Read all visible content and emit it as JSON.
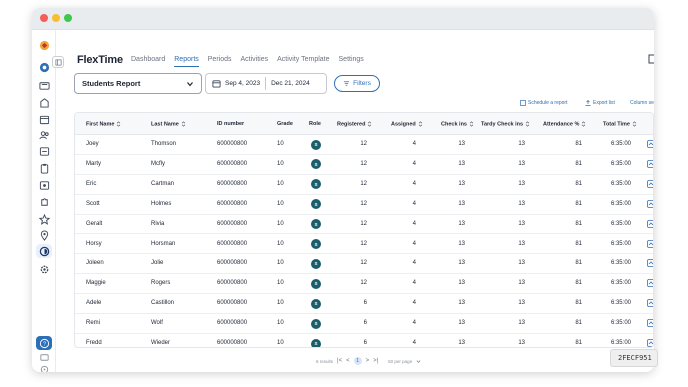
{
  "app": {
    "brand": "FlexTime",
    "nav": [
      "Dashboard",
      "Reports",
      "Periods",
      "Activities",
      "Activity Template",
      "Settings"
    ],
    "active_nav": "Reports"
  },
  "toolbar": {
    "report_select": "Students Report",
    "date_start": "Sep 4, 2023",
    "date_end": "Dec 21, 2024",
    "filters_label": "Filters",
    "schedule_label": "Schedule a report",
    "export_label": "Export list",
    "columns_label": "Column se"
  },
  "table": {
    "columns": [
      "First Name",
      "Last Name",
      "ID number",
      "Grade",
      "Role",
      "Registered",
      "Assigned",
      "Check ins",
      "Tardy Check ins",
      "Attendance %",
      "Total Time"
    ],
    "rows": [
      [
        "Joey",
        "Thomson",
        "600000800",
        "10",
        "S",
        "12",
        "4",
        "13",
        "13",
        "81",
        "6:35:00"
      ],
      [
        "Marty",
        "Mcfly",
        "600000800",
        "10",
        "S",
        "12",
        "4",
        "13",
        "13",
        "81",
        "6:35:00"
      ],
      [
        "Eric",
        "Cartman",
        "600000800",
        "10",
        "S",
        "12",
        "4",
        "13",
        "13",
        "81",
        "6:35:00"
      ],
      [
        "Scott",
        "Holmes",
        "600000800",
        "10",
        "S",
        "12",
        "4",
        "13",
        "13",
        "81",
        "6:35:00"
      ],
      [
        "Geralt",
        "Rivia",
        "600000800",
        "10",
        "S",
        "12",
        "4",
        "13",
        "13",
        "81",
        "6:35:00"
      ],
      [
        "Horsy",
        "Horsman",
        "600000800",
        "10",
        "S",
        "12",
        "4",
        "13",
        "13",
        "81",
        "6:35:00"
      ],
      [
        "Joleen",
        "Jolie",
        "600000800",
        "10",
        "S",
        "12",
        "4",
        "13",
        "13",
        "81",
        "6:35:00"
      ],
      [
        "Maggie",
        "Rogers",
        "600000800",
        "10",
        "S",
        "12",
        "4",
        "13",
        "13",
        "81",
        "6:35:00"
      ],
      [
        "Adele",
        "Castillon",
        "600000800",
        "10",
        "S",
        "6",
        "4",
        "13",
        "13",
        "81",
        "6:35:00"
      ],
      [
        "Remi",
        "Wolf",
        "600000800",
        "10",
        "S",
        "6",
        "4",
        "13",
        "13",
        "81",
        "6:35:00"
      ],
      [
        "Fredd",
        "Wieder",
        "600000800",
        "10",
        "S",
        "6",
        "4",
        "13",
        "13",
        "81",
        "6:35:00"
      ]
    ]
  },
  "pagination": {
    "results_text": "6 results",
    "current_page": "1",
    "per_page": "50 per page"
  },
  "badge": "2FECF951",
  "colors": {
    "accent": "#2f6fb3",
    "role_dot": "#1b5e6b"
  }
}
